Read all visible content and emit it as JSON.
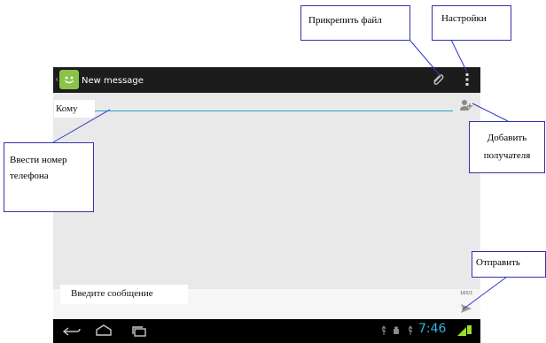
{
  "app": {
    "title": "New message",
    "to_label": "Кому",
    "compose_placeholder": "Введите сообщение",
    "char_counter": "160/1",
    "clock": "7:46",
    "icons": {
      "app": "messaging-app-icon",
      "attach": "paperclip-icon",
      "menu": "overflow-menu-icon",
      "add_contact": "add-contact-icon",
      "send": "send-icon",
      "nav": [
        "nav-back-icon",
        "nav-home-icon",
        "nav-recent-apps-icon"
      ],
      "status": [
        "usb-icon",
        "android-debug-icon",
        "usb-icon",
        "signal-icon",
        "battery-icon"
      ]
    },
    "colors": {
      "action_bar": "#1c1c1c",
      "accent": "#29a3c8",
      "clock": "#33b5e5",
      "app_icon": "#8bc34a"
    }
  },
  "callouts": {
    "attach_file": "Прикрепить файл",
    "settings": "Настройки",
    "enter_phone_line1": "Ввести номер",
    "enter_phone_line2": "телефона",
    "add_recipient_line1": "Добавить",
    "add_recipient_line2": "получателя",
    "send": "Отправить"
  }
}
